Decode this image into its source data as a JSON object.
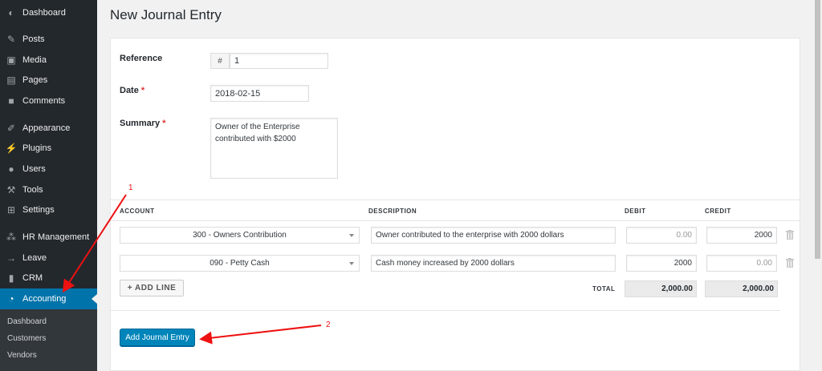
{
  "page": {
    "title": "New Journal Entry"
  },
  "sidebar": {
    "items": [
      {
        "label": "Dashboard",
        "icon": "dashboard-icon",
        "glyph": "◐"
      },
      {
        "label": "Posts",
        "icon": "pin-icon",
        "glyph": "✎"
      },
      {
        "label": "Media",
        "icon": "media-icon",
        "glyph": "▣"
      },
      {
        "label": "Pages",
        "icon": "pages-icon",
        "glyph": "▤"
      },
      {
        "label": "Comments",
        "icon": "comments-icon",
        "glyph": "■"
      },
      {
        "label": "Appearance",
        "icon": "brush-icon",
        "glyph": "✐"
      },
      {
        "label": "Plugins",
        "icon": "plugin-icon",
        "glyph": "⚡"
      },
      {
        "label": "Users",
        "icon": "users-icon",
        "glyph": "●"
      },
      {
        "label": "Tools",
        "icon": "wrench-icon",
        "glyph": "⚒"
      },
      {
        "label": "Settings",
        "icon": "settings-icon",
        "glyph": "⊞"
      },
      {
        "label": "HR Management",
        "icon": "hr-icon",
        "glyph": "⁂"
      },
      {
        "label": "Leave",
        "icon": "arrow-right-icon",
        "glyph": "→"
      },
      {
        "label": "CRM",
        "icon": "chart-bars-icon",
        "glyph": "▮"
      },
      {
        "label": "Accounting",
        "icon": "pie-chart-icon",
        "glyph": "◔"
      }
    ],
    "submenu": [
      "Dashboard",
      "Customers",
      "Vendors"
    ],
    "active_color": "#0073aa"
  },
  "form": {
    "reference": {
      "label": "Reference",
      "prefix": "#",
      "value": "1"
    },
    "date": {
      "label": "Date",
      "required": "*",
      "value": "2018-02-15"
    },
    "summary": {
      "label": "Summary",
      "required": "*",
      "value": "Owner of the Enterprise contributed with $2000"
    }
  },
  "table": {
    "headers": {
      "account": "ACCOUNT",
      "description": "DESCRIPTION",
      "debit": "DEBIT",
      "credit": "CREDIT"
    },
    "rows": [
      {
        "account": "300 - Owners Contribution",
        "description": "Owner contributed to the enterprise with 2000 dollars",
        "debit": "0.00",
        "credit": "2000"
      },
      {
        "account": "090 - Petty Cash",
        "description": "Cash money increased by 2000 dollars",
        "debit": "2000",
        "credit": "0.00"
      }
    ],
    "add_line_label": "+ ADD LINE",
    "total_label": "TOTAL",
    "total_debit": "2,000.00",
    "total_credit": "2,000.00"
  },
  "submit_label": "Add Journal Entry",
  "annotations": {
    "one": "1",
    "two": "2",
    "color": "#ee1111"
  }
}
